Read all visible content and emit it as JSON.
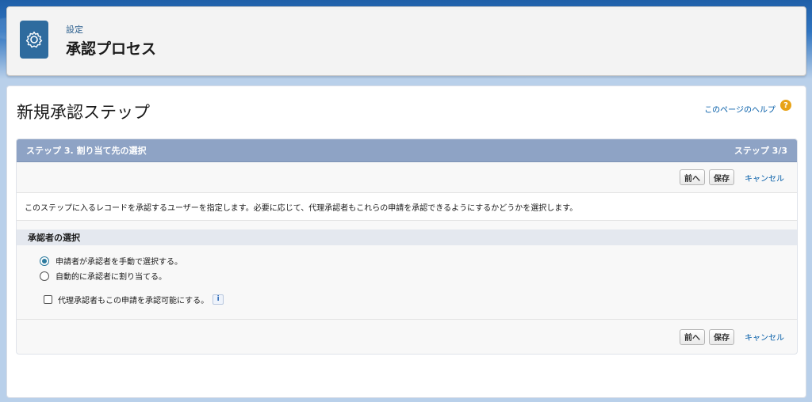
{
  "header": {
    "eyebrow": "設定",
    "title": "承認プロセス",
    "icon": "gear-icon"
  },
  "page": {
    "title": "新規承認ステップ",
    "help_link": "このページのヘルプ",
    "help_icon": "?"
  },
  "step": {
    "title": "ステップ 3. 割り当て先の選択",
    "counter": "ステップ 3/3",
    "description": "このステップに入るレコードを承認するユーザーを指定します。必要に応じて、代理承認者もこれらの申請を承認できるようにするかどうかを選択します。"
  },
  "buttons": {
    "previous": "前へ",
    "save": "保存",
    "cancel": "キャンセル"
  },
  "approver_section": {
    "title": "承認者の選択",
    "options": [
      {
        "label": "申請者が承認者を手動で選択する。",
        "selected": true
      },
      {
        "label": "自動的に承認者に割り当てる。",
        "selected": false
      }
    ],
    "delegate_checkbox": {
      "label": "代理承認者もこの申請を承認可能にする。",
      "checked": false
    },
    "info_icon": "i"
  },
  "colors": {
    "step_header": "#8ea3c5",
    "link": "#015ba7",
    "radio_selected": "#2b7a9e",
    "header_icon_bg": "#2e6b9e"
  }
}
